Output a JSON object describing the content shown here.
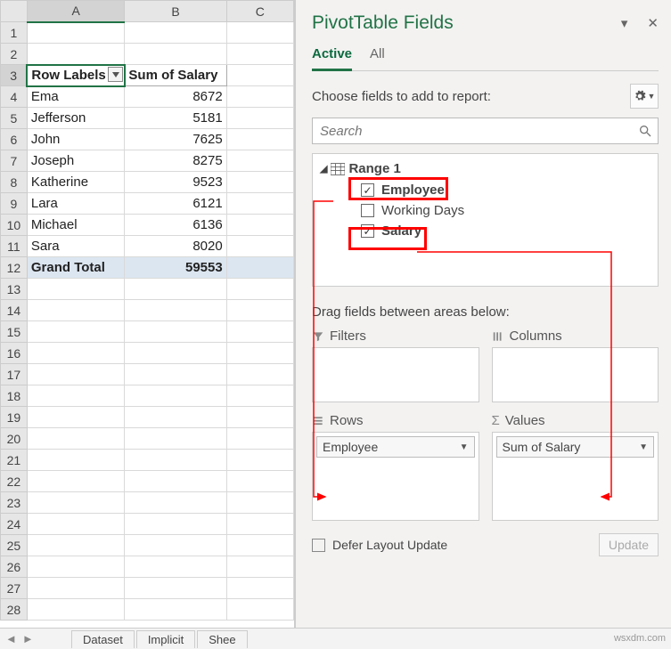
{
  "columns": [
    "A",
    "B",
    "C"
  ],
  "header": {
    "rowlabels": "Row Labels",
    "sumsalary": "Sum of Salary"
  },
  "rows": [
    {
      "name": "Ema",
      "val": "8672"
    },
    {
      "name": "Jefferson",
      "val": "5181"
    },
    {
      "name": "John",
      "val": "7625"
    },
    {
      "name": "Joseph",
      "val": "8275"
    },
    {
      "name": "Katherine",
      "val": "9523"
    },
    {
      "name": "Lara",
      "val": "6121"
    },
    {
      "name": "Michael",
      "val": "6136"
    },
    {
      "name": "Sara",
      "val": "8020"
    }
  ],
  "grand": {
    "label": "Grand Total",
    "val": "59553"
  },
  "tabs": {
    "t1": "Dataset",
    "t2": "Implicit",
    "t3": "Shee"
  },
  "pane": {
    "title": "PivotTable Fields",
    "view_active": "Active",
    "view_all": "All",
    "choose": "Choose fields to add to report:",
    "search_ph": "Search",
    "range": "Range 1",
    "f_emp": "Employee",
    "f_wd": "Working Days",
    "f_sal": "Salary",
    "drag": "Drag fields between areas below:",
    "filters": "Filters",
    "columns": "Columns",
    "rowsarea": "Rows",
    "values": "Values",
    "drop_emp": "Employee",
    "drop_sal": "Sum of Salary",
    "defer": "Defer Layout Update",
    "update": "Update"
  },
  "watermark": "wsxdm.com"
}
